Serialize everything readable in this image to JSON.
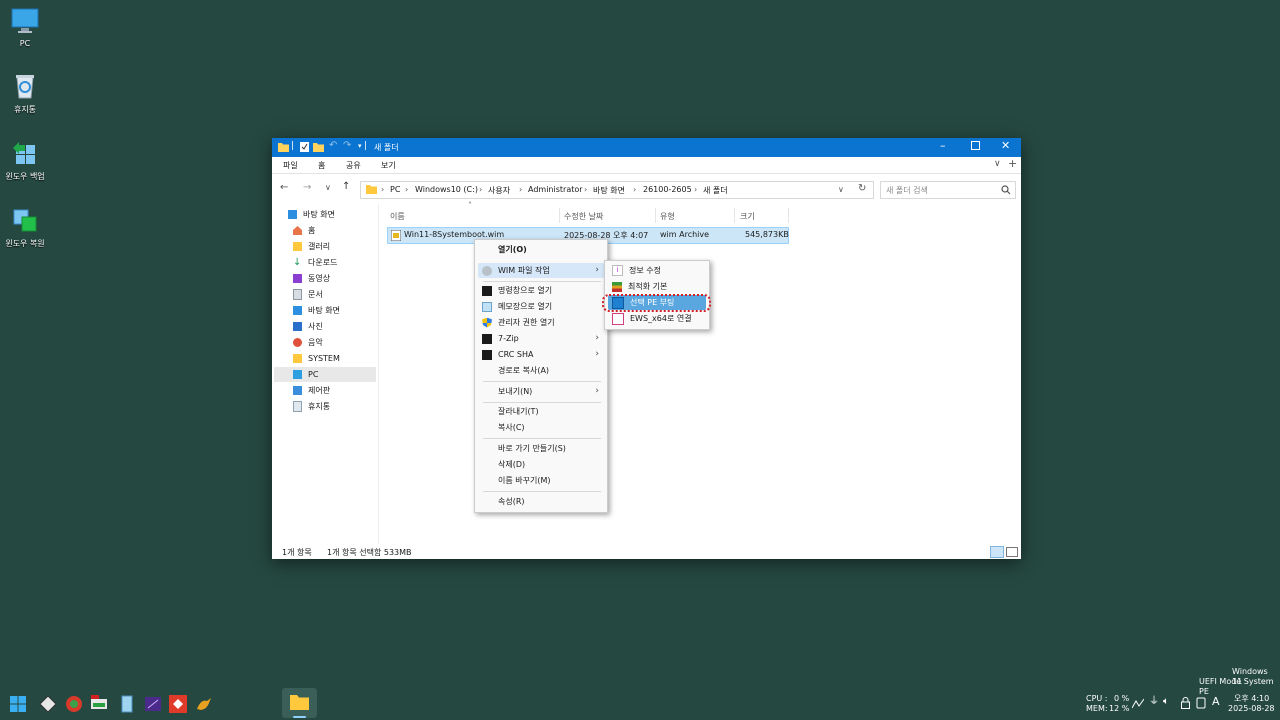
{
  "desktop": {
    "icons": [
      {
        "label": "PC"
      },
      {
        "label": "휴지통"
      },
      {
        "label": "윈도우 백업"
      },
      {
        "label": "윈도우 복원"
      }
    ]
  },
  "window": {
    "title": "새 폴더",
    "ribbon_tabs": [
      "파일",
      "홈",
      "공유",
      "보기"
    ],
    "breadcrumb": [
      "PC",
      "Windows10 (C:)",
      "사용자",
      "Administrator",
      "바탕 화면",
      "26100-2605",
      "새 폴더"
    ],
    "search_placeholder": "새 폴더 검색",
    "nav_items": [
      {
        "label": "바탕 화면"
      },
      {
        "label": "홈"
      },
      {
        "label": "갤러리"
      },
      {
        "label": "다운로드"
      },
      {
        "label": "동영상"
      },
      {
        "label": "문서"
      },
      {
        "label": "바탕 화면"
      },
      {
        "label": "사진"
      },
      {
        "label": "음악"
      },
      {
        "label": "SYSTEM"
      },
      {
        "label": "PC"
      },
      {
        "label": "제어판"
      },
      {
        "label": "휴지통"
      }
    ],
    "columns": {
      "name": "이름",
      "modified": "수정한 날짜",
      "type": "유형",
      "size": "크기"
    },
    "file": {
      "name": "Win11-8Systemboot.wim",
      "modified": "2025-08-28 오후 4:07",
      "type": "wim Archive",
      "size": "545,873KB"
    },
    "status": {
      "count": "1개 항목",
      "selected": "1개 항목 선택함 533MB"
    }
  },
  "context_menu": {
    "items": [
      {
        "label": "열기(O)"
      },
      {
        "label": "WIM 파일 작업"
      },
      {
        "label": "명령창으로  열기"
      },
      {
        "label": "메모장으로  열기"
      },
      {
        "label": "관리자 권한 열기"
      },
      {
        "label": "7-Zip"
      },
      {
        "label": "CRC SHA"
      },
      {
        "label": "경로로 복사(A)"
      },
      {
        "label": "보내기(N)"
      },
      {
        "label": "잘라내기(T)"
      },
      {
        "label": "복사(C)"
      },
      {
        "label": "바로 가기 만들기(S)"
      },
      {
        "label": "삭제(D)"
      },
      {
        "label": "이름 바꾸기(M)"
      },
      {
        "label": "속성(R)"
      }
    ]
  },
  "submenu": {
    "items": [
      {
        "label": "정보 수정"
      },
      {
        "label": "최적화 기본"
      },
      {
        "label": "선택 PE 부팅"
      },
      {
        "label": "EWS_x64로 연결"
      }
    ]
  },
  "taskbar": {
    "watermark_line1": "Windows 11",
    "watermark_line2": "UEFI Mode System PE",
    "cpu_label": "CPU :",
    "cpu_value": "0 %",
    "mem_label": "MEM:",
    "mem_value": "12 %",
    "ime": "A",
    "time": "오후 4:10",
    "date": "2025-08-28"
  },
  "colors": {
    "accent": "#0b74d1",
    "desktop": "#254840",
    "highlight": "#cde6f7",
    "focus_ring": "#d0202a"
  }
}
